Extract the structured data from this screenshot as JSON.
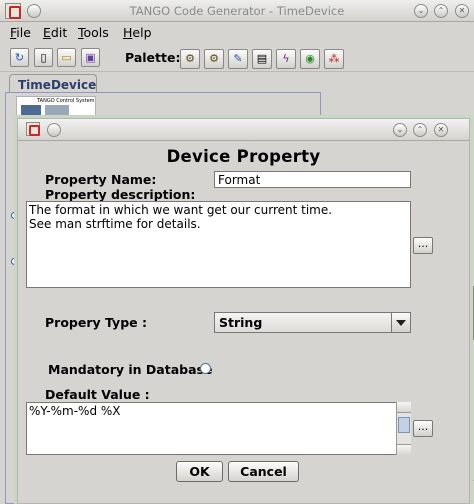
{
  "main_window": {
    "title": "TANGO Code Generator - TimeDevice",
    "menu": [
      "File",
      "Edit",
      "Tools",
      "Help"
    ],
    "toolbar_icons": [
      "refresh-icon",
      "new-file-icon",
      "open-folder-icon",
      "save-icon"
    ],
    "palette_label": "Palette:",
    "palette_icons": [
      "command-icon",
      "attribute-icon",
      "property-icon",
      "state-icon",
      "signal-icon",
      "eye-icon",
      "colors-icon"
    ],
    "tab_label": "TimeDevice",
    "thumbnail_header": "TANGO Control System"
  },
  "dialog": {
    "heading": "Device  Property",
    "property_name_label": "Property Name:",
    "property_name_value": "Format",
    "description_label": "Property description:",
    "description_value": "The format in which we want get our current time.\nSee man strftime for details.",
    "ellipsis_label": "...",
    "type_label": "Propery Type :",
    "type_value": "String",
    "mandatory_label": "Mandatory in Database",
    "default_label": "Default Value :",
    "default_value": "%Y-%m-%d %X",
    "ok_label": "OK",
    "cancel_label": "Cancel"
  }
}
